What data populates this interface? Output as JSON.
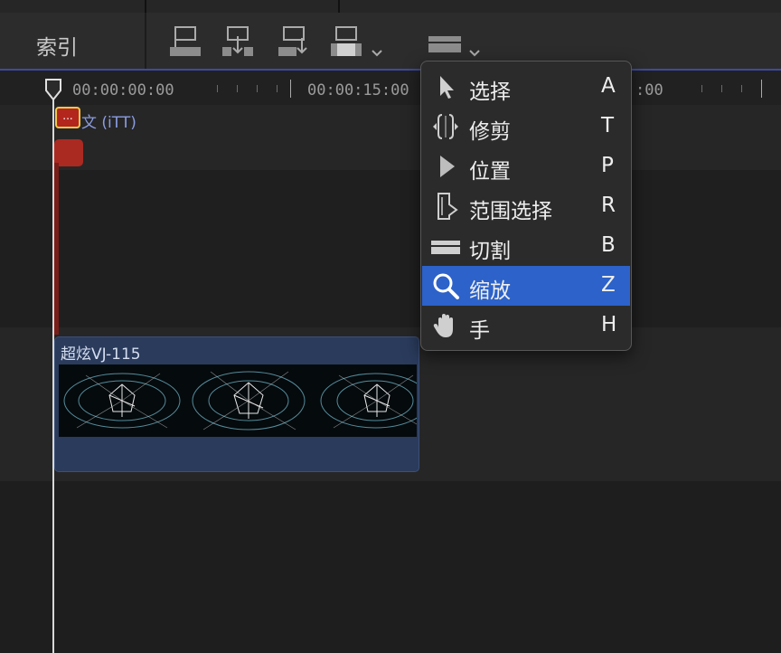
{
  "toolbar": {
    "index_label": "索引",
    "buttons": [
      "connect-clip",
      "insert-clip",
      "append-clip",
      "overwrite-clip",
      "tool-select"
    ]
  },
  "timeline": {
    "timecodes": [
      "00:00:00:00",
      "00:00:15:00",
      ":00"
    ],
    "caption_label": "文 (iTT)",
    "caption_marker_text": "...",
    "video_clip_title": "超炫VJ-115"
  },
  "tool_menu": {
    "items": [
      {
        "label": "选择",
        "key": "A",
        "icon": "arrow-cursor-icon",
        "selected": false
      },
      {
        "label": "修剪",
        "key": "T",
        "icon": "trim-icon",
        "selected": false
      },
      {
        "label": "位置",
        "key": "P",
        "icon": "position-arrow-icon",
        "selected": false
      },
      {
        "label": "范围选择",
        "key": "R",
        "icon": "range-select-icon",
        "selected": false
      },
      {
        "label": "切割",
        "key": "B",
        "icon": "blade-icon",
        "selected": false
      },
      {
        "label": "缩放",
        "key": "Z",
        "icon": "zoom-icon",
        "selected": true
      },
      {
        "label": "手",
        "key": "H",
        "icon": "hand-icon",
        "selected": false
      }
    ]
  },
  "colors": {
    "menu_highlight": "#2c62c9",
    "caption_red": "#b3261e",
    "video_clip": "#2a3b5c",
    "toolbar_accent": "#3d4aa0"
  }
}
